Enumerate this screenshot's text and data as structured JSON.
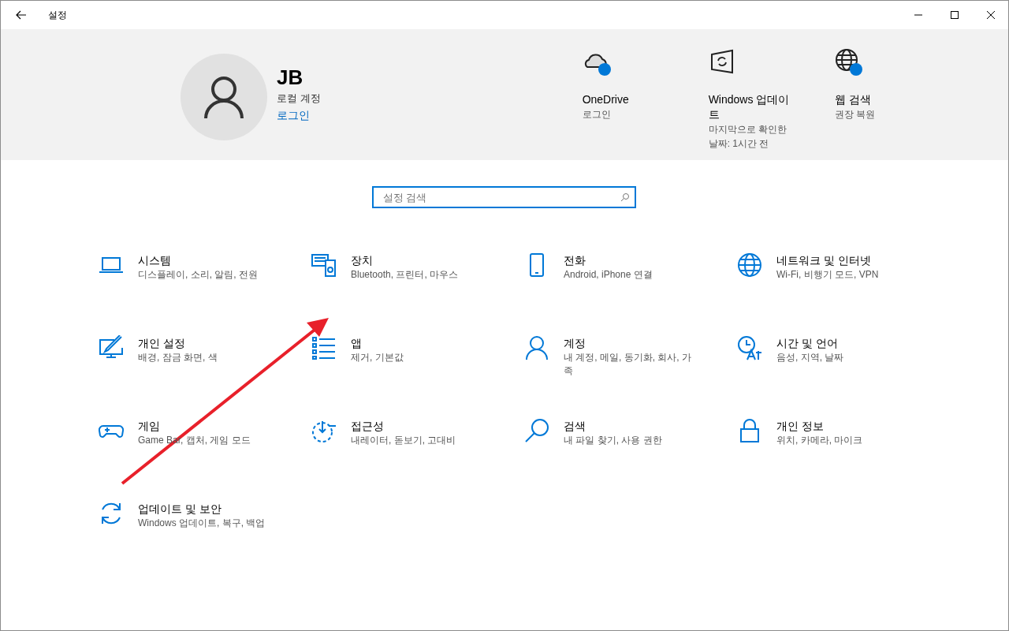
{
  "window": {
    "title": "설정"
  },
  "account": {
    "name": "JB",
    "type": "로컬 계정",
    "link": "로그인"
  },
  "status": [
    {
      "kind": "cloud",
      "title": "OneDrive",
      "lines": [
        "로그인"
      ]
    },
    {
      "kind": "update",
      "title": "Windows 업데이트",
      "lines": [
        "마지막으로 확인한 날짜: 1시간 전"
      ]
    },
    {
      "kind": "globe",
      "title": "웹 검색",
      "lines": [
        "권장 복원"
      ]
    }
  ],
  "search": {
    "placeholder": "설정 검색"
  },
  "categories": [
    {
      "kind": "laptop",
      "title": "시스템",
      "desc": "디스플레이, 소리, 알림, 전원"
    },
    {
      "kind": "devices",
      "title": "장치",
      "desc": "Bluetooth, 프린터, 마우스"
    },
    {
      "kind": "phone",
      "title": "전화",
      "desc": "Android, iPhone 연결"
    },
    {
      "kind": "globe",
      "title": "네트워크 및 인터넷",
      "desc": "Wi-Fi, 비행기 모드, VPN"
    },
    {
      "kind": "paint",
      "title": "개인 설정",
      "desc": "배경, 잠금 화면, 색"
    },
    {
      "kind": "apps",
      "title": "앱",
      "desc": "제거, 기본값"
    },
    {
      "kind": "person",
      "title": "계정",
      "desc": "내 계정, 메일, 동기화, 회사, 가족"
    },
    {
      "kind": "time",
      "title": "시간 및 언어",
      "desc": "음성, 지역, 날짜"
    },
    {
      "kind": "gamepad",
      "title": "게임",
      "desc": "Game Bar, 캡처, 게임 모드"
    },
    {
      "kind": "access",
      "title": "접근성",
      "desc": "내레이터, 돋보기, 고대비"
    },
    {
      "kind": "search",
      "title": "검색",
      "desc": "내 파일 찾기, 사용 권한"
    },
    {
      "kind": "lock",
      "title": "개인 정보",
      "desc": "위치, 카메라, 마이크"
    },
    {
      "kind": "sync",
      "title": "업데이트 및 보안",
      "desc": "Windows 업데이트, 복구, 백업"
    }
  ]
}
